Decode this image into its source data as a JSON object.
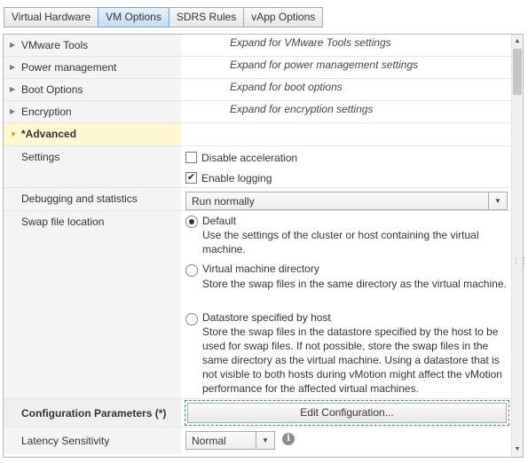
{
  "tabs": [
    {
      "label": "Virtual Hardware",
      "active": false
    },
    {
      "label": "VM Options",
      "active": true
    },
    {
      "label": "SDRS Rules",
      "active": false
    },
    {
      "label": "vApp Options",
      "active": false
    }
  ],
  "sections": {
    "vmware_tools": {
      "label": "VMware Tools",
      "hint": "Expand for VMware Tools settings"
    },
    "power_management": {
      "label": "Power management",
      "hint": "Expand for power management settings"
    },
    "boot_options": {
      "label": "Boot Options",
      "hint": "Expand for boot options"
    },
    "encryption": {
      "label": "Encryption",
      "hint": "Expand for encryption settings"
    },
    "advanced": {
      "label": "*Advanced"
    }
  },
  "advanced": {
    "settings": {
      "label": "Settings",
      "disable_acceleration": {
        "label": "Disable acceleration",
        "checked": false
      },
      "enable_logging": {
        "label": "Enable logging",
        "checked": true
      }
    },
    "debugging": {
      "label": "Debugging and statistics",
      "value": "Run normally"
    },
    "swap": {
      "label": "Swap file location",
      "options": [
        {
          "title": "Default",
          "desc": "Use the settings of the cluster or host containing the virtual machine.",
          "selected": true
        },
        {
          "title": "Virtual machine directory",
          "desc": "Store the swap files in the same directory as the virtual machine.",
          "selected": false
        },
        {
          "title": "Datastore specified by host",
          "desc": "Store the swap files in the datastore specified by the host to be used for swap files. If not possible, store the swap files in the same directory as the virtual machine. Using a datastore that is not visible to both hosts during vMotion might affect the vMotion performance for the affected virtual machines.",
          "selected": false
        }
      ]
    },
    "config_params": {
      "label": "Configuration Parameters (*)",
      "button": "Edit Configuration..."
    },
    "latency": {
      "label": "Latency Sensitivity",
      "value": "Normal"
    }
  },
  "icons": {
    "collapsed": "chevron-right-icon",
    "expanded": "chevron-down-icon",
    "dropdown": "caret-down-icon",
    "info": "info-icon",
    "check": "checkmark-icon"
  },
  "colors": {
    "active_tab": "#c8dcf2",
    "highlight_row": "#fdf7d2",
    "focus_border": "#2e9b47"
  }
}
